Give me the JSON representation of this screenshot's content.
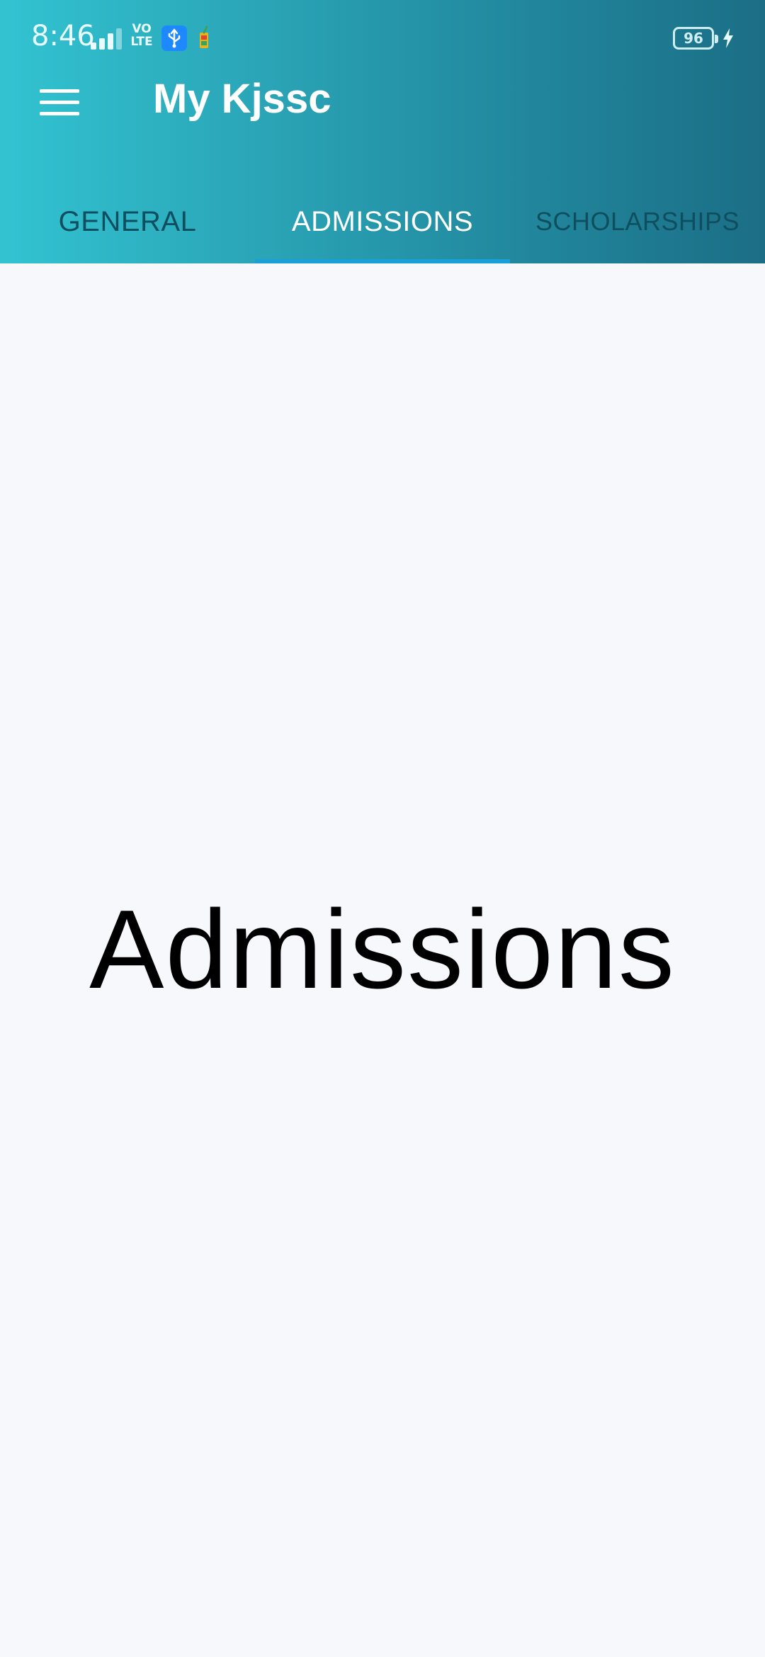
{
  "status_bar": {
    "time": "8:46",
    "network_label": "VO\nLTE",
    "battery_level": "96",
    "icons": [
      "signal-icon",
      "volte-icon",
      "usb-icon",
      "app-notification-icon",
      "battery-icon",
      "charging-icon"
    ]
  },
  "toolbar": {
    "title": "My Kjssc",
    "menu_icon": "hamburger-menu-icon"
  },
  "tabs": [
    {
      "label": "GENERAL",
      "active": false
    },
    {
      "label": "ADMISSIONS",
      "active": true
    },
    {
      "label": "SCHOLARSHIPS",
      "active": false
    }
  ],
  "content": {
    "heading": "Admissions"
  },
  "colors": {
    "header_gradient_start": "#32c3d1",
    "header_gradient_end": "#1b6e86",
    "tab_indicator": "#1a9fd6",
    "inactive_tab_text": "#0f4e5e",
    "background": "#f7f8fc"
  }
}
